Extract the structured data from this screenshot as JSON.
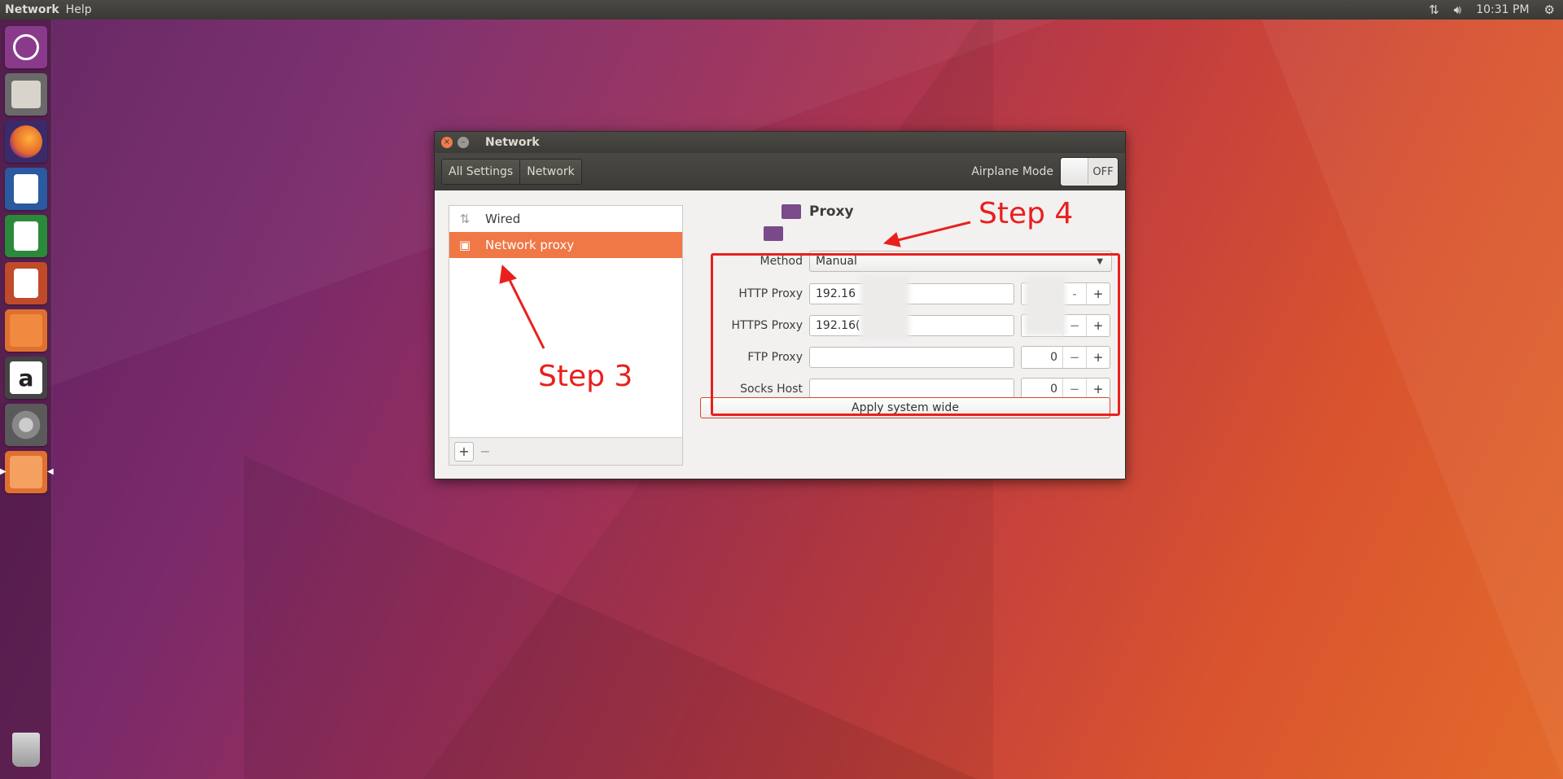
{
  "top_panel": {
    "app_name": "Network",
    "menu_help": "Help",
    "time": "10:31 PM",
    "icons": [
      "network-arrows-icon",
      "volume-icon",
      "gear-icon"
    ]
  },
  "launcher": {
    "items": [
      {
        "name": "ubuntu-dash-icon",
        "color": "#8a3a8a"
      },
      {
        "name": "file-cabinet-icon",
        "color": "#6a6a6a"
      },
      {
        "name": "firefox-icon",
        "color": "#e36a2c"
      },
      {
        "name": "writer-icon",
        "color": "#2a5aa0"
      },
      {
        "name": "calc-icon",
        "color": "#2a8a3a"
      },
      {
        "name": "impress-icon",
        "color": "#c04a2a"
      },
      {
        "name": "software-center-icon",
        "color": "#e07030"
      },
      {
        "name": "amazon-icon",
        "color": "#444444"
      },
      {
        "name": "system-settings-icon",
        "color": "#5a5a5a"
      },
      {
        "name": "files-folder-icon",
        "color": "#e07030"
      },
      {
        "name": "trash-icon",
        "color": "#7a7a7a"
      }
    ],
    "amazon_glyph": "a"
  },
  "window": {
    "title": "Network",
    "breadcrumbs": [
      "All Settings",
      "Network"
    ],
    "airplane_label": "Airplane Mode",
    "airplane_state": "OFF",
    "sidebar": {
      "items": [
        {
          "label": "Wired",
          "selected": false
        },
        {
          "label": "Network proxy",
          "selected": true
        }
      ],
      "add": "+",
      "remove": "−"
    },
    "proxy": {
      "heading": "Proxy",
      "method_label": "Method",
      "method_value": "Manual",
      "rows": [
        {
          "label": "HTTP Proxy",
          "host": "192.16",
          "port": "",
          "minus": "-",
          "plus": "+"
        },
        {
          "label": "HTTPS Proxy",
          "host": "192.16(",
          "port": "",
          "minus": "−",
          "plus": "+"
        },
        {
          "label": "FTP Proxy",
          "host": "",
          "port": "0",
          "minus": "−",
          "plus": "+"
        },
        {
          "label": "Socks Host",
          "host": "",
          "port": "0",
          "minus": "−",
          "plus": "+"
        }
      ],
      "apply": "Apply system wide"
    }
  },
  "annotations": {
    "step3": "Step 3",
    "step4": "Step 4",
    "color": "#e8201e"
  }
}
